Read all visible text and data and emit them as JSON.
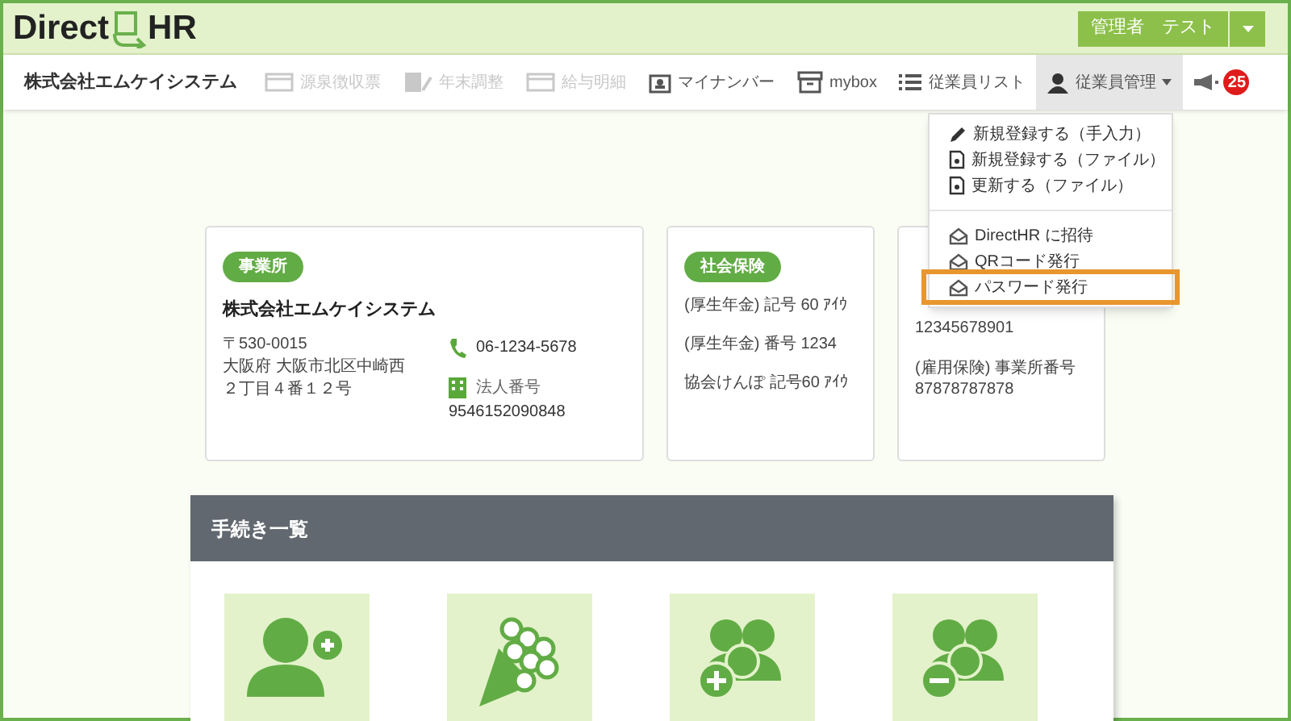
{
  "header": {
    "logo_left": "Direct",
    "logo_right": "HR",
    "user_button": "管理者　テスト"
  },
  "navbar": {
    "company": "株式会社エムケイシステム",
    "items": [
      {
        "label": "源泉徴収票",
        "disabled": true,
        "selected": false
      },
      {
        "label": "年末調整",
        "disabled": true,
        "selected": false
      },
      {
        "label": "給与明細",
        "disabled": true,
        "selected": false
      },
      {
        "label": "マイナンバー",
        "disabled": false,
        "selected": false
      },
      {
        "label": "mybox",
        "disabled": false,
        "selected": false
      },
      {
        "label": "従業員リスト",
        "disabled": false,
        "selected": false
      },
      {
        "label": "従業員管理",
        "disabled": false,
        "selected": true
      }
    ],
    "notification_count": "25"
  },
  "dropdown": {
    "groups": [
      [
        {
          "label": "新規登録する（手入力）",
          "highlighted": false
        },
        {
          "label": "新規登録する（ファイル）",
          "highlighted": false
        },
        {
          "label": "更新する（ファイル）",
          "highlighted": false
        }
      ],
      [
        {
          "label": "DirectHR に招待",
          "highlighted": false
        },
        {
          "label": "QRコード発行",
          "highlighted": false
        },
        {
          "label": "パスワード発行",
          "highlighted": true
        }
      ]
    ]
  },
  "cards": [
    {
      "badge": "事業所",
      "title": "株式会社エムケイシステム",
      "address": [
        "〒530-0015",
        "大阪府 大阪市北区中崎西",
        "２丁目４番１２号"
      ],
      "phone": "06-1234-5678",
      "corp_label": "法人番号",
      "corp_number": "9546152090848"
    },
    {
      "badge": "社会保険",
      "lines": [
        "(厚生年金) 記号 60 ｱｲｳ",
        "(厚生年金) 番号 1234",
        "協会けんぽ 記号60 ｱｲｳ"
      ]
    },
    {
      "lines": [
        "12345678901",
        "(雇用保険) 事業所番号",
        "87878787878"
      ]
    }
  ],
  "procedures": {
    "title": "手続き一覧",
    "tiles": [
      {
        "kind": "person-add"
      },
      {
        "kind": "bouquet"
      },
      {
        "kind": "group-add"
      },
      {
        "kind": "group-remove"
      }
    ]
  }
}
